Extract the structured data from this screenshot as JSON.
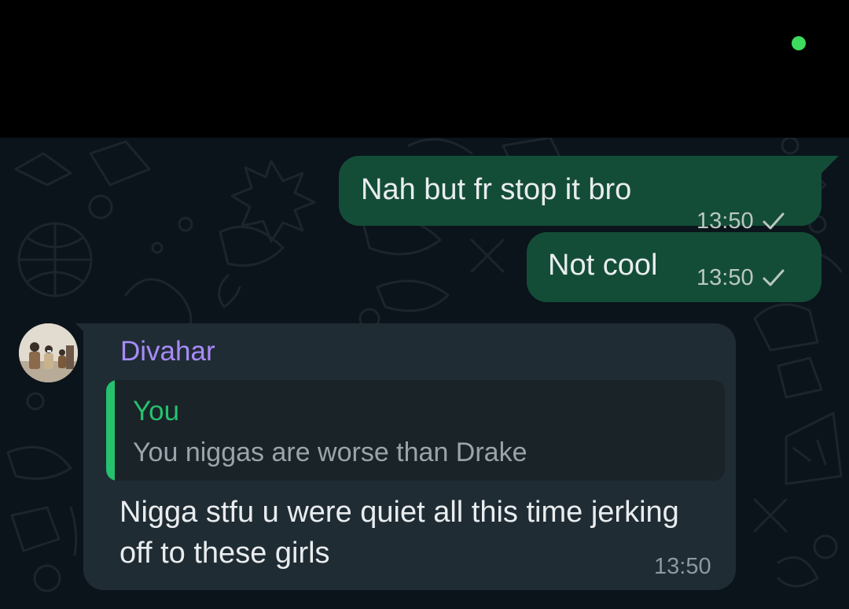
{
  "colors": {
    "status_bar_bg": "#000000",
    "privacy_dot": "#3ddc5f",
    "chat_bg": "#0b141a",
    "outgoing_bubble": "#144d37",
    "incoming_bubble": "#202c33",
    "sender_name": "#a78bfa",
    "quote_accent": "#25c16f"
  },
  "messages": {
    "outgoing": [
      {
        "text": "Nah but fr stop it bro",
        "time": "13:50",
        "status_icon": "single-check-icon"
      },
      {
        "text": "Not cool",
        "time": "13:50",
        "status_icon": "single-check-icon"
      }
    ],
    "incoming": {
      "sender": "Divahar",
      "avatar_icon": "group-photo-avatar",
      "quote": {
        "author": "You",
        "text": "You niggas are worse than Drake"
      },
      "text": "Nigga stfu u were quiet all this time jerking off to these girls",
      "time": "13:50"
    }
  }
}
